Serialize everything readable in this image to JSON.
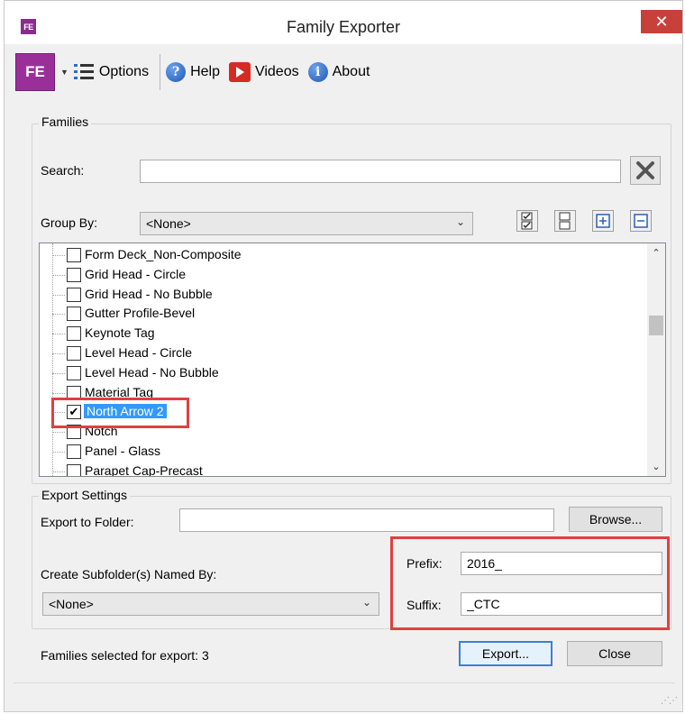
{
  "window": {
    "title": "Family Exporter",
    "close_glyph": "✕",
    "app_icon_text": "FE"
  },
  "toolbar": {
    "logo_text": "FE",
    "options_label": "Options",
    "help_label": "Help",
    "videos_label": "Videos",
    "about_label": "About"
  },
  "families": {
    "group_label": "Families",
    "search_label": "Search:",
    "search_value": "",
    "group_by_label": "Group By:",
    "group_by_value": "<None>",
    "items": [
      {
        "label": "Form Deck_Non-Composite",
        "checked": false
      },
      {
        "label": "Grid Head - Circle",
        "checked": false
      },
      {
        "label": "Grid Head - No Bubble",
        "checked": false
      },
      {
        "label": "Gutter Profile-Bevel",
        "checked": false
      },
      {
        "label": "Keynote Tag",
        "checked": false
      },
      {
        "label": "Level Head - Circle",
        "checked": false
      },
      {
        "label": "Level Head - No Bubble",
        "checked": false
      },
      {
        "label": "Material Tag",
        "checked": false
      },
      {
        "label": "North Arrow 2",
        "checked": true,
        "selected": true
      },
      {
        "label": "Notch",
        "checked": false
      },
      {
        "label": "Panel - Glass",
        "checked": false
      },
      {
        "label": "Parapet Cap-Precast",
        "checked": false
      }
    ]
  },
  "export": {
    "group_label": "Export Settings",
    "folder_label": "Export to Folder:",
    "folder_value": "",
    "browse_label": "Browse...",
    "subfolder_label": "Create Subfolder(s) Named By:",
    "subfolder_value": "<None>",
    "prefix_label": "Prefix:",
    "prefix_value": "2016_",
    "suffix_label": "Suffix:",
    "suffix_value": "_CTC"
  },
  "footer": {
    "status": "Families selected for export: 3",
    "export_label": "Export...",
    "close_label": "Close"
  },
  "colors": {
    "highlight_box": "#e04040",
    "selection": "#3399ff",
    "brand": "#9b2f9a"
  }
}
